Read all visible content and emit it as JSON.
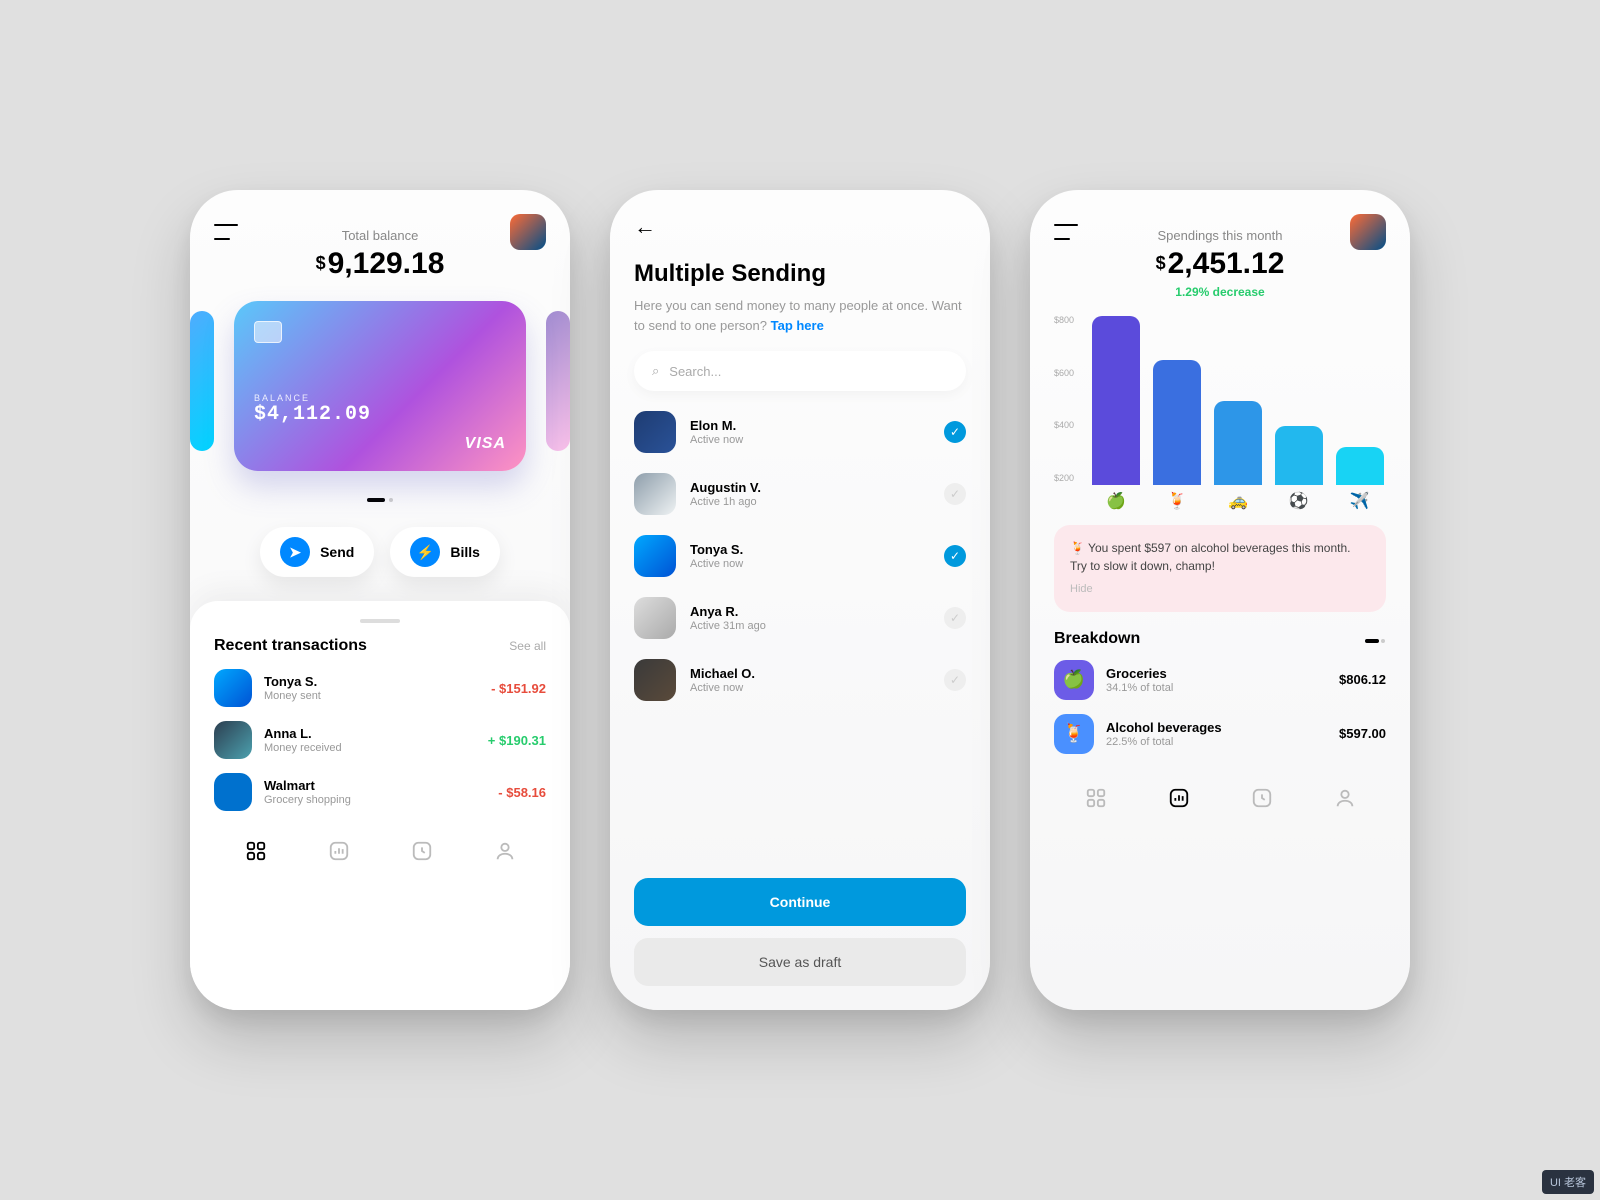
{
  "screen1": {
    "balance_label": "Total balance",
    "balance_amount": "9,129.18",
    "card": {
      "balance_label": "BALANCE",
      "balance": "$4,112.09",
      "brand": "VISA"
    },
    "actions": {
      "send": "Send",
      "bills": "Bills"
    },
    "recent_title": "Recent transactions",
    "see_all": "See all",
    "transactions": [
      {
        "name": "Tonya S.",
        "sub": "Money sent",
        "amount": "- $151.92",
        "cls": "neg",
        "bg": "linear-gradient(135deg,#00a8ff,#0052d4)"
      },
      {
        "name": "Anna L.",
        "sub": "Money received",
        "amount": "+ $190.31",
        "cls": "pos",
        "bg": "linear-gradient(135deg,#2c3e50,#4ca1af)"
      },
      {
        "name": "Walmart",
        "sub": "Grocery shopping",
        "amount": "- $58.16",
        "cls": "neg",
        "bg": "#0071ce"
      }
    ]
  },
  "screen2": {
    "title": "Multiple Sending",
    "desc1": "Here you can send money to many people at once. Want to send to one person? ",
    "link": "Tap here",
    "search_placeholder": "Search...",
    "contacts": [
      {
        "name": "Elon M.",
        "sub": "Active now",
        "checked": true,
        "bg": "linear-gradient(135deg,#1e3c72,#2a5298)"
      },
      {
        "name": "Augustin V.",
        "sub": "Active 1h ago",
        "checked": false,
        "bg": "linear-gradient(135deg,#8e9eab,#eef2f3)"
      },
      {
        "name": "Tonya S.",
        "sub": "Active now",
        "checked": true,
        "bg": "linear-gradient(135deg,#00a8ff,#0052d4)"
      },
      {
        "name": "Anya R.",
        "sub": "Active 31m ago",
        "checked": false,
        "bg": "linear-gradient(135deg,#ddd,#aaa)"
      },
      {
        "name": "Michael O.",
        "sub": "Active now",
        "checked": false,
        "bg": "linear-gradient(135deg,#3a3a3a,#5a4a3a)"
      }
    ],
    "continue": "Continue",
    "draft": "Save as draft"
  },
  "screen3": {
    "title_label": "Spendings this month",
    "amount": "2,451.12",
    "change": "1.29% decrease",
    "yticks": [
      "$800",
      "$600",
      "$400",
      "$200"
    ],
    "alert_text": "🍹 You spent $597 on alcohol beverages this month. Try to slow it down, champ!",
    "alert_hide": "Hide",
    "breakdown_title": "Breakdown",
    "breakdown": [
      {
        "name": "Groceries",
        "sub": "34.1% of total",
        "amount": "$806.12",
        "icon": "🍏",
        "bg": "#6c5ce7"
      },
      {
        "name": "Alcohol beverages",
        "sub": "22.5% of total",
        "amount": "$597.00",
        "icon": "🍹",
        "bg": "#4a90ff"
      }
    ]
  },
  "chart_data": {
    "type": "bar",
    "title": "Spendings this month",
    "ylabel": "$",
    "ylim": [
      0,
      800
    ],
    "categories": [
      "Groceries",
      "Alcohol",
      "Transport",
      "Sports",
      "Travel"
    ],
    "icons": [
      "🍏",
      "🍹",
      "🚕",
      "⚽",
      "✈️"
    ],
    "values": [
      806,
      597,
      400,
      280,
      180
    ],
    "colors": [
      "#5b4bdb",
      "#3a6fe0",
      "#2d96e8",
      "#22b8ee",
      "#18d3f4"
    ]
  },
  "watermark": "UI 老客"
}
